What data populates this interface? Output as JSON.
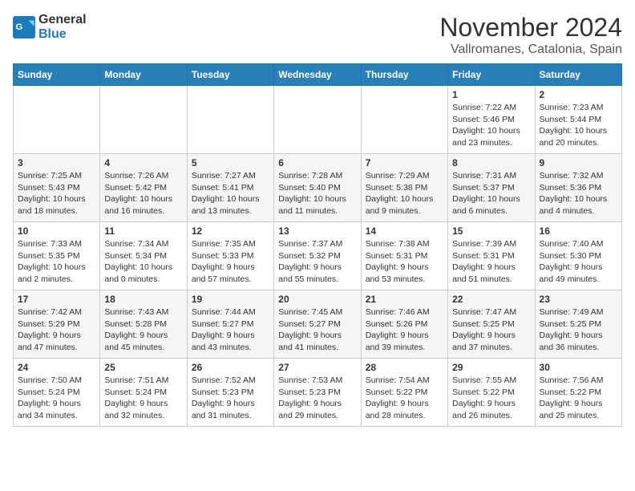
{
  "logo": {
    "line1": "General",
    "line2": "Blue"
  },
  "title": "November 2024",
  "location": "Vallromanes, Catalonia, Spain",
  "weekdays": [
    "Sunday",
    "Monday",
    "Tuesday",
    "Wednesday",
    "Thursday",
    "Friday",
    "Saturday"
  ],
  "weeks": [
    [
      {
        "day": "",
        "info": ""
      },
      {
        "day": "",
        "info": ""
      },
      {
        "day": "",
        "info": ""
      },
      {
        "day": "",
        "info": ""
      },
      {
        "day": "",
        "info": ""
      },
      {
        "day": "1",
        "info": "Sunrise: 7:22 AM\nSunset: 5:46 PM\nDaylight: 10 hours and 23 minutes."
      },
      {
        "day": "2",
        "info": "Sunrise: 7:23 AM\nSunset: 5:44 PM\nDaylight: 10 hours and 20 minutes."
      }
    ],
    [
      {
        "day": "3",
        "info": "Sunrise: 7:25 AM\nSunset: 5:43 PM\nDaylight: 10 hours and 18 minutes."
      },
      {
        "day": "4",
        "info": "Sunrise: 7:26 AM\nSunset: 5:42 PM\nDaylight: 10 hours and 16 minutes."
      },
      {
        "day": "5",
        "info": "Sunrise: 7:27 AM\nSunset: 5:41 PM\nDaylight: 10 hours and 13 minutes."
      },
      {
        "day": "6",
        "info": "Sunrise: 7:28 AM\nSunset: 5:40 PM\nDaylight: 10 hours and 11 minutes."
      },
      {
        "day": "7",
        "info": "Sunrise: 7:29 AM\nSunset: 5:38 PM\nDaylight: 10 hours and 9 minutes."
      },
      {
        "day": "8",
        "info": "Sunrise: 7:31 AM\nSunset: 5:37 PM\nDaylight: 10 hours and 6 minutes."
      },
      {
        "day": "9",
        "info": "Sunrise: 7:32 AM\nSunset: 5:36 PM\nDaylight: 10 hours and 4 minutes."
      }
    ],
    [
      {
        "day": "10",
        "info": "Sunrise: 7:33 AM\nSunset: 5:35 PM\nDaylight: 10 hours and 2 minutes."
      },
      {
        "day": "11",
        "info": "Sunrise: 7:34 AM\nSunset: 5:34 PM\nDaylight: 10 hours and 0 minutes."
      },
      {
        "day": "12",
        "info": "Sunrise: 7:35 AM\nSunset: 5:33 PM\nDaylight: 9 hours and 57 minutes."
      },
      {
        "day": "13",
        "info": "Sunrise: 7:37 AM\nSunset: 5:32 PM\nDaylight: 9 hours and 55 minutes."
      },
      {
        "day": "14",
        "info": "Sunrise: 7:38 AM\nSunset: 5:31 PM\nDaylight: 9 hours and 53 minutes."
      },
      {
        "day": "15",
        "info": "Sunrise: 7:39 AM\nSunset: 5:31 PM\nDaylight: 9 hours and 51 minutes."
      },
      {
        "day": "16",
        "info": "Sunrise: 7:40 AM\nSunset: 5:30 PM\nDaylight: 9 hours and 49 minutes."
      }
    ],
    [
      {
        "day": "17",
        "info": "Sunrise: 7:42 AM\nSunset: 5:29 PM\nDaylight: 9 hours and 47 minutes."
      },
      {
        "day": "18",
        "info": "Sunrise: 7:43 AM\nSunset: 5:28 PM\nDaylight: 9 hours and 45 minutes."
      },
      {
        "day": "19",
        "info": "Sunrise: 7:44 AM\nSunset: 5:27 PM\nDaylight: 9 hours and 43 minutes."
      },
      {
        "day": "20",
        "info": "Sunrise: 7:45 AM\nSunset: 5:27 PM\nDaylight: 9 hours and 41 minutes."
      },
      {
        "day": "21",
        "info": "Sunrise: 7:46 AM\nSunset: 5:26 PM\nDaylight: 9 hours and 39 minutes."
      },
      {
        "day": "22",
        "info": "Sunrise: 7:47 AM\nSunset: 5:25 PM\nDaylight: 9 hours and 37 minutes."
      },
      {
        "day": "23",
        "info": "Sunrise: 7:49 AM\nSunset: 5:25 PM\nDaylight: 9 hours and 36 minutes."
      }
    ],
    [
      {
        "day": "24",
        "info": "Sunrise: 7:50 AM\nSunset: 5:24 PM\nDaylight: 9 hours and 34 minutes."
      },
      {
        "day": "25",
        "info": "Sunrise: 7:51 AM\nSunset: 5:24 PM\nDaylight: 9 hours and 32 minutes."
      },
      {
        "day": "26",
        "info": "Sunrise: 7:52 AM\nSunset: 5:23 PM\nDaylight: 9 hours and 31 minutes."
      },
      {
        "day": "27",
        "info": "Sunrise: 7:53 AM\nSunset: 5:23 PM\nDaylight: 9 hours and 29 minutes."
      },
      {
        "day": "28",
        "info": "Sunrise: 7:54 AM\nSunset: 5:22 PM\nDaylight: 9 hours and 28 minutes."
      },
      {
        "day": "29",
        "info": "Sunrise: 7:55 AM\nSunset: 5:22 PM\nDaylight: 9 hours and 26 minutes."
      },
      {
        "day": "30",
        "info": "Sunrise: 7:56 AM\nSunset: 5:22 PM\nDaylight: 9 hours and 25 minutes."
      }
    ]
  ]
}
